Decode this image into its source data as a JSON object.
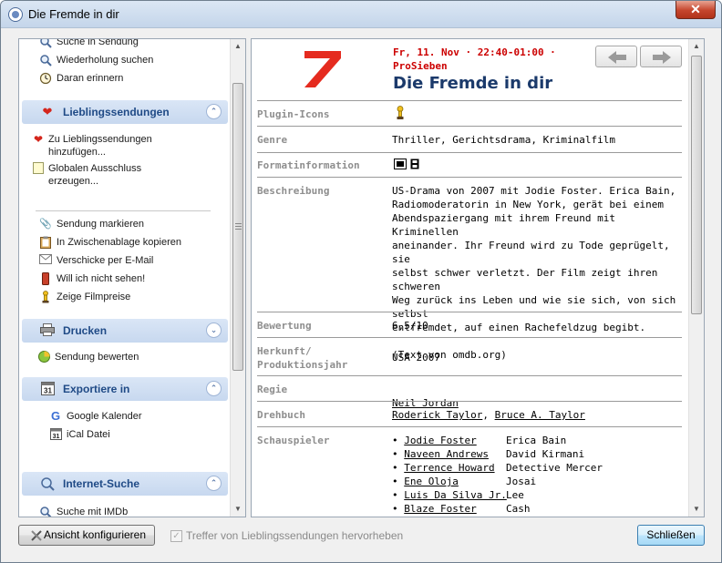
{
  "window": {
    "title": "Die Fremde in dir",
    "close_label": "✕"
  },
  "left": {
    "items_top": [
      {
        "label": "Suche in Sendung",
        "icon": "magnifier-icon"
      },
      {
        "label": "Wiederholung suchen",
        "icon": "magnifier-icon"
      },
      {
        "label": "Daran erinnern",
        "icon": "alarm-clock-icon"
      }
    ],
    "sections": {
      "favorites": {
        "label": "Lieblingssendungen",
        "toggle": "collapse"
      },
      "print": {
        "label": "Drucken",
        "toggle": "expand"
      },
      "export": {
        "label": "Exportiere in",
        "toggle": "collapse"
      },
      "search": {
        "label": "Internet-Suche",
        "toggle": "collapse"
      }
    },
    "favorites_items": [
      {
        "line1": "Zu Lieblingssendungen",
        "line2": "hinzufügen...",
        "icon": "heart-icon"
      },
      {
        "line1": "Globalen Ausschluss",
        "line2": "erzeugen...",
        "icon": "note-icon"
      }
    ],
    "actions": [
      {
        "label": "Sendung markieren",
        "icon": "paperclip-icon"
      },
      {
        "label": "In Zwischenablage kopieren",
        "icon": "clipboard-icon"
      },
      {
        "label": "Verschicke per E-Mail",
        "icon": "mail-icon"
      },
      {
        "label": "Will ich nicht sehen!",
        "icon": "stop-icon"
      },
      {
        "label": "Zeige Filmpreise",
        "icon": "trophy-icon"
      }
    ],
    "rate_item": {
      "label": "Sendung bewerten",
      "icon": "rating-icon"
    },
    "export_items": [
      {
        "label": "Google Kalender",
        "icon": "google-icon"
      },
      {
        "label": "iCal Datei",
        "icon": "calendar-icon"
      }
    ],
    "search_items": [
      {
        "label": "Suche mit IMDb",
        "icon": "magnifier-icon"
      }
    ]
  },
  "detail": {
    "datetime_line1": "Fr, 11. Nov · 22:40-01:00 ·",
    "channel": "ProSieben",
    "title": "Die Fremde in dir",
    "rows": {
      "plugin_icons": {
        "label": "Plugin-Icons"
      },
      "genre": {
        "label": "Genre",
        "value": "Thriller, Gerichtsdrama, Kriminalfilm"
      },
      "format": {
        "label": "Formatinformation"
      },
      "description": {
        "label": "Beschreibung",
        "value": "US-Drama von 2007 mit Jodie Foster. Erica Bain,\nRadiomoderatorin in New York, gerät bei einem\nAbendspaziergang mit ihrem Freund mit Kriminellen\naneinander. Ihr Freund wird zu Tode geprügelt, sie\nselbst schwer verletzt. Der Film zeigt ihren schweren\nWeg zurück ins Leben und wie sie sich, von sich selbst\nentfremdet, auf einen Rachefeldzug begibt.\n\n(Text von omdb.org)"
      },
      "rating": {
        "label": "Bewertung",
        "value": "6,5/10"
      },
      "origin": {
        "label_line1": "Herkunft/",
        "label_line2": "Produktionsjahr",
        "value": "USA 2007"
      },
      "director": {
        "label": "Regie",
        "value": "Neil Jordan"
      },
      "screenplay": {
        "label": "Drehbuch",
        "writer1": "Roderick Taylor",
        "separator": ", ",
        "writer2": "Bruce A. Taylor"
      },
      "cast": {
        "label": "Schauspieler",
        "members": [
          {
            "name": "Jodie Foster",
            "role": "Erica Bain"
          },
          {
            "name": "Naveen Andrews",
            "role": "David Kirmani"
          },
          {
            "name": "Terrence Howard",
            "role": "Detective Mercer"
          },
          {
            "name": "Ene Oloja",
            "role": "Josai"
          },
          {
            "name": "Luis Da Silva Jr.",
            "role": "Lee"
          },
          {
            "name": "Blaze Foster",
            "role": "Cash"
          }
        ]
      }
    }
  },
  "footer": {
    "configure_label": "Ansicht konfigurieren",
    "highlight_label": "Treffer von Lieblingssendungen hervorheben",
    "highlight_checked": true,
    "close_label": "Schließen"
  },
  "colors": {
    "accent": "#1f4a86",
    "time_red": "#cc0000",
    "title_blue": "#1b3a6b",
    "logo_red": "#e52b1f"
  }
}
